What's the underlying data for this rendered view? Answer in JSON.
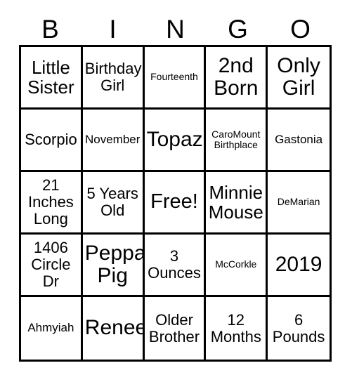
{
  "card": {
    "type": "bingo-card",
    "columns": 5,
    "rows": 5,
    "header": {
      "letters": [
        "B",
        "I",
        "N",
        "G",
        "O"
      ]
    },
    "free_space": {
      "label": "Free!",
      "row": 3,
      "column": 3
    },
    "colors": {
      "background": "#ffffff",
      "text": "#000000",
      "border": "#000000"
    },
    "cells": [
      {
        "text": "Little\nSister",
        "size": "fs-lg"
      },
      {
        "text": "Birthday\nGirl",
        "size": "fs-md"
      },
      {
        "text": "Fourteenth",
        "size": "fs-xs"
      },
      {
        "text": "2nd\nBorn",
        "size": "fs-xl"
      },
      {
        "text": "Only\nGirl",
        "size": "fs-xl"
      },
      {
        "text": "Scorpio",
        "size": "fs-md"
      },
      {
        "text": "November",
        "size": "fs-sm"
      },
      {
        "text": "Topaz",
        "size": "fs-xl"
      },
      {
        "text": "CaroMount\nBirthplace",
        "size": "fs-xs"
      },
      {
        "text": "Gastonia",
        "size": "fs-sm"
      },
      {
        "text": "21\nInches\nLong",
        "size": "fs-md"
      },
      {
        "text": "5 Years\nOld",
        "size": "fs-md"
      },
      {
        "text": "Free!",
        "size": "fs-free"
      },
      {
        "text": "Minnie\nMouse",
        "size": "fs-lg"
      },
      {
        "text": "DeMarian",
        "size": "fs-xs"
      },
      {
        "text": "1406\nCircle\nDr",
        "size": "fs-md"
      },
      {
        "text": "Peppa\nPig",
        "size": "fs-xl"
      },
      {
        "text": "3\nOunces",
        "size": "fs-md"
      },
      {
        "text": "McCorkle",
        "size": "fs-xs"
      },
      {
        "text": "2019",
        "size": "fs-xl"
      },
      {
        "text": "Ahmyiah",
        "size": "fs-sm"
      },
      {
        "text": "Renee",
        "size": "fs-xl"
      },
      {
        "text": "Older\nBrother",
        "size": "fs-md"
      },
      {
        "text": "12\nMonths",
        "size": "fs-md"
      },
      {
        "text": "6\nPounds",
        "size": "fs-md"
      }
    ]
  }
}
